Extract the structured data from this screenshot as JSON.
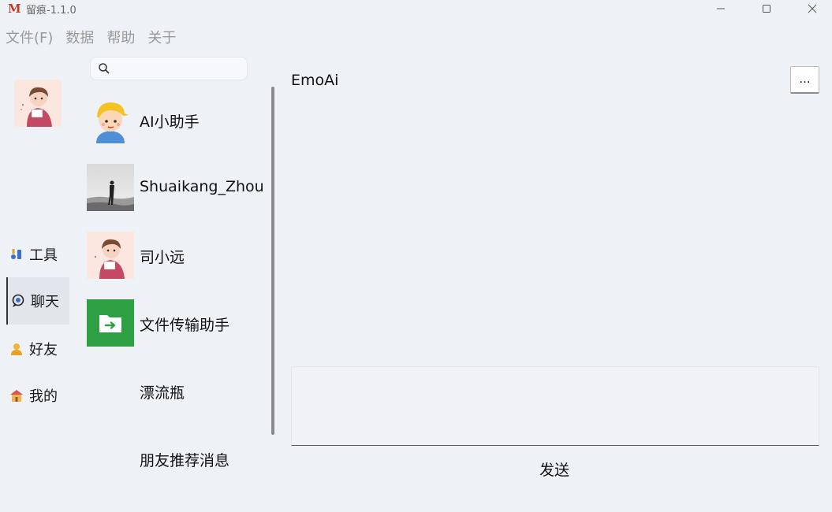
{
  "window": {
    "logo": "M",
    "title": "留痕-1.1.0",
    "minimize_icon": "minimize-icon",
    "maximize_icon": "maximize-icon",
    "close_icon": "close-icon"
  },
  "menu": [
    {
      "label": "文件(F)"
    },
    {
      "label": "数据"
    },
    {
      "label": "帮助"
    },
    {
      "label": "关于"
    }
  ],
  "nav": {
    "items": [
      {
        "label": "工具",
        "icon": "tools-icon"
      },
      {
        "label": "聊天",
        "icon": "chat-icon",
        "active": true
      },
      {
        "label": "好友",
        "icon": "friend-icon"
      },
      {
        "label": "我的",
        "icon": "home-icon"
      }
    ]
  },
  "search": {
    "placeholder": "",
    "value": ""
  },
  "contacts": [
    {
      "name": "AI小助手",
      "avatar": "cartoon-boy-cap-avatar"
    },
    {
      "name": "Shuaikang_Zhou",
      "avatar": "photo-silhouette-avatar"
    },
    {
      "name": "司小远",
      "avatar": "cartoon-kid-avatar"
    },
    {
      "name": "文件传输助手",
      "avatar": "green-folder-avatar"
    },
    {
      "name": "漂流瓶",
      "avatar": ""
    },
    {
      "name": "朋友推荐消息",
      "avatar": ""
    }
  ],
  "chat": {
    "title": "EmoAi",
    "more_label": "...",
    "send_label": "发送",
    "input_value": ""
  },
  "colors": {
    "background": "#eef1f5",
    "logo": "#c0392b",
    "folder_green": "#2ea043"
  }
}
